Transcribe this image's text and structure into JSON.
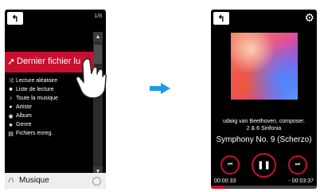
{
  "left_screen": {
    "back_label": "↰",
    "page_indicator": "1/8",
    "highlighted_item": "Dernier fichier lu",
    "menu_items": [
      {
        "icon": "shuffle-icon",
        "glyph": "⤨",
        "label": "Lecture aléatoire"
      },
      {
        "icon": "playlist-icon",
        "glyph": "■",
        "label": "Liste de lecture"
      },
      {
        "icon": "music-note-icon",
        "glyph": "♪",
        "label": "Toute la musique"
      },
      {
        "icon": "artist-icon",
        "glyph": "●",
        "label": "Artiste"
      },
      {
        "icon": "album-icon",
        "glyph": "◉",
        "label": "Album"
      },
      {
        "icon": "star-icon",
        "glyph": "★",
        "label": "Genre"
      },
      {
        "icon": "folder-icon",
        "glyph": "▤",
        "label": "Fichiers enreg."
      }
    ],
    "bottom_label": "Musique"
  },
  "right_screen": {
    "back_label": "↰",
    "artist_line1": "udwig van Beethoven, composer.",
    "artist_line2": "2 & 6 Sinfonia",
    "track_title": "Symphony No. 9 (Scherzo)",
    "time_elapsed": "00:00:33",
    "time_remaining": "- 00:03:37",
    "progress": 0.13
  },
  "colors": {
    "accent": "#c8102e",
    "arrow": "#1e9be6"
  }
}
